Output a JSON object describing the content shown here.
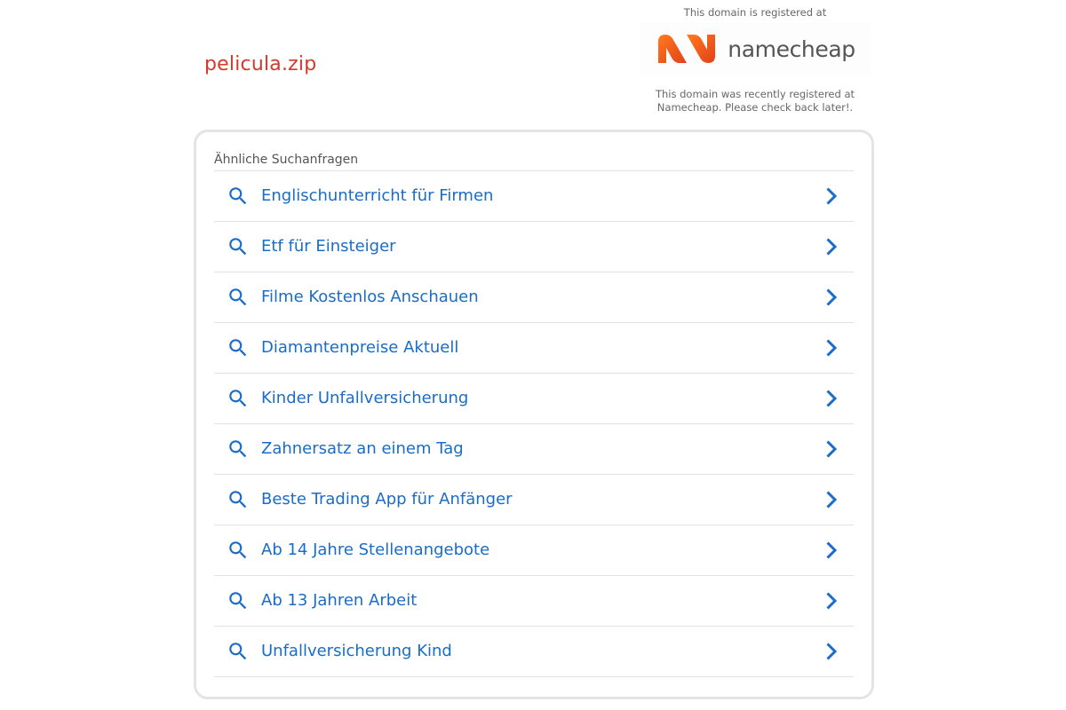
{
  "header": {
    "domain": "pelicula.zip"
  },
  "registrar": {
    "registered_at_text": "This domain is registered at",
    "logo_text": "namecheap",
    "note_line1": "This domain was recently registered at",
    "note_line2": "Namecheap. Please check back later!.",
    "logo_colors": [
      "#ff6b1a",
      "#e2411a"
    ]
  },
  "related": {
    "heading": "Ähnliche Suchanfragen",
    "link_color": "#1a6cc8",
    "items": [
      {
        "label": "Englischunterricht für Firmen"
      },
      {
        "label": "Etf für Einsteiger"
      },
      {
        "label": "Filme Kostenlos Anschauen"
      },
      {
        "label": "Diamantenpreise Aktuell"
      },
      {
        "label": "Kinder Unfallversicherung"
      },
      {
        "label": "Zahnersatz an einem Tag"
      },
      {
        "label": "Beste Trading App für Anfänger"
      },
      {
        "label": "Ab 14 Jahre Stellenangebote"
      },
      {
        "label": "Ab 13 Jahren Arbeit"
      },
      {
        "label": "Unfallversicherung Kind"
      }
    ],
    "item_icon": "search-icon",
    "item_action_icon": "chevron-right-icon"
  }
}
